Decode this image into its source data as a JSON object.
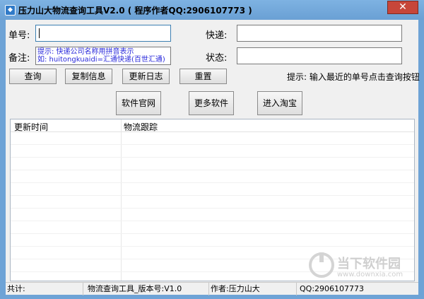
{
  "window": {
    "title": "压力山大物流查询工具V2.0 ( 程序作者QQ:2906107773 )",
    "close_glyph": "✕"
  },
  "form": {
    "tracking_label": "单号:",
    "tracking_value": "",
    "courier_label": "快递:",
    "courier_value": "",
    "remark_label": "备注:",
    "remark_line1": "提示: 快递公司名称用拼音表示",
    "remark_line2": "如: huitongkuaidi=汇通快递(百世汇通)",
    "status_label": "状态:",
    "status_value": ""
  },
  "buttons": {
    "query": "查询",
    "copy_info": "复制信息",
    "update_log": "更新日志",
    "reset": "重置",
    "official_site": "软件官网",
    "more_software": "更多软件",
    "taobao": "进入淘宝"
  },
  "hint": "提示: 输入最近的单号点击查询按钮",
  "table": {
    "columns": [
      "更新时间",
      "物流跟踪"
    ]
  },
  "watermark": {
    "text": "当下软件园",
    "url": "www.downxia.com"
  },
  "statusbar": {
    "total": "共计:",
    "version": "物流查询工具_版本号:V1.0",
    "author": "作者:压力山大",
    "qq": "QQ:2906107773"
  },
  "colors": {
    "title_bar": "#6ea3d6",
    "close_button": "#c7463a",
    "hint_text": "#2a2adb"
  }
}
